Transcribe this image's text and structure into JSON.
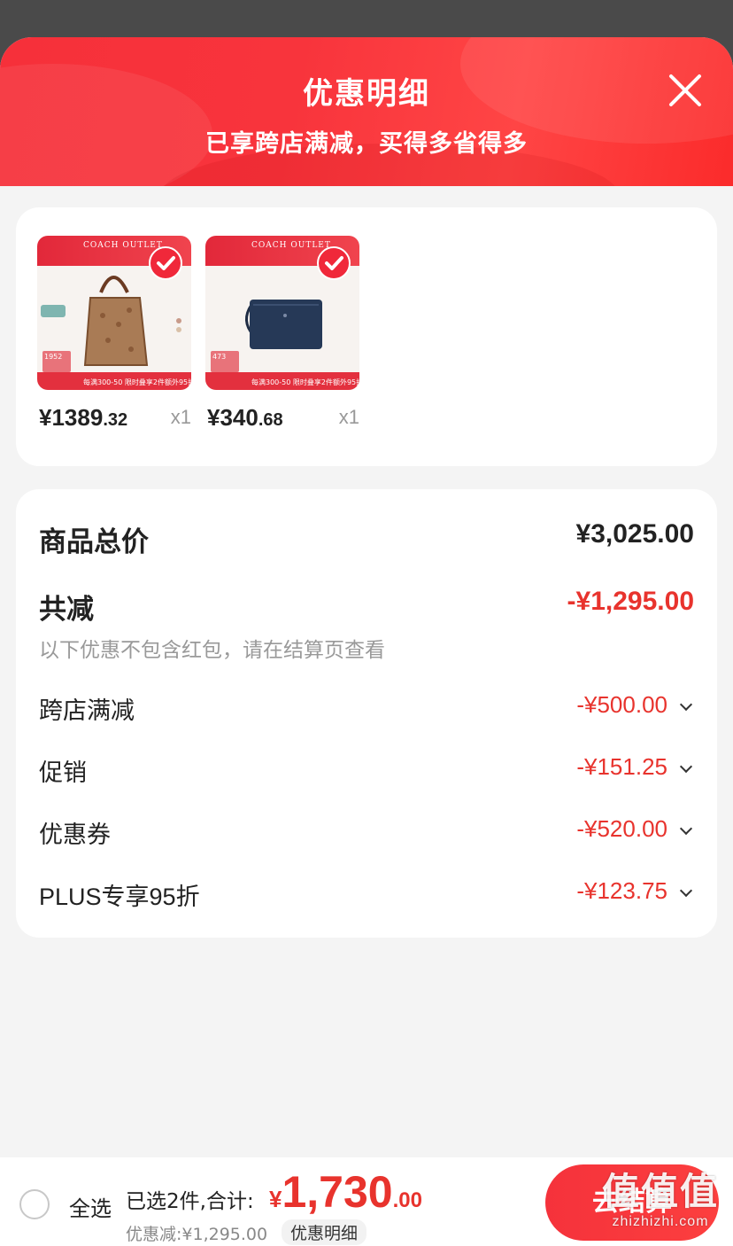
{
  "header": {
    "title": "优惠明细",
    "subtitle": "已享跨店满减，买得多省得多",
    "close_icon": "close-icon"
  },
  "products": [
    {
      "image_icon": "coach-tote-bag-image",
      "thumb_brand": "COACH OUTLET",
      "thumb_band": "每满300-50 限时叠享2件额外95折",
      "thumb_sold": "1952",
      "price_int": "¥1389",
      "price_dec": ".32",
      "qty": "x1",
      "checked": true
    },
    {
      "image_icon": "coach-wristlet-image",
      "thumb_brand": "COACH OUTLET",
      "thumb_band": "每满300-50 限时叠享2件额外95折",
      "thumb_sold": "473",
      "price_int": "¥340",
      "price_dec": ".68",
      "qty": "x1",
      "checked": true
    }
  ],
  "summary": {
    "total_label": "商品总价",
    "total_value": "¥3,025.00",
    "reduce_label": "共减",
    "reduce_value": "-¥1,295.00",
    "note": "以下优惠不包含红包，请在结算页查看",
    "items": [
      {
        "label": "跨店满减",
        "value": "-¥500.00"
      },
      {
        "label": "促销",
        "value": "-¥151.25"
      },
      {
        "label": "优惠券",
        "value": "-¥520.00"
      },
      {
        "label": "PLUS专享95折",
        "value": "-¥123.75"
      }
    ]
  },
  "footer": {
    "select_all": "全选",
    "selected_info": "已选2件,合计:",
    "total_currency": "¥",
    "total_int": "1,730",
    "total_dec": ".00",
    "discount_line": "优惠减:¥1,295.00",
    "detail_link": "优惠明细",
    "checkout": "去结算",
    "watermark_big": "值值值",
    "watermark_small": "zhizhizhi.com"
  },
  "colors": {
    "accent_red": "#e8332d",
    "header_red": "#f6303a"
  }
}
